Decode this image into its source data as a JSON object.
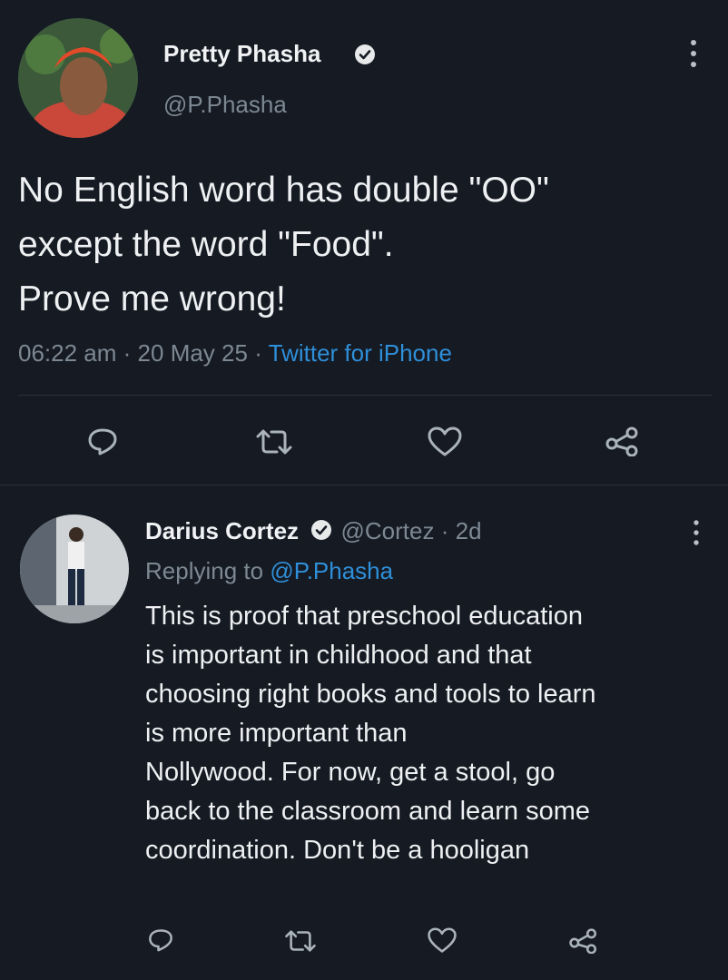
{
  "tweet": {
    "author_name": "Pretty Phasha",
    "author_handle": "@P.Phasha",
    "text_lines": [
      "No English word has double \"OO\"",
      "except the word \"Food\".",
      "Prove me wrong!"
    ],
    "time": "06:22 am",
    "date": "20 May 25",
    "source": "Twitter for iPhone",
    "separator": "·"
  },
  "reply": {
    "author_name": "Darius Cortez",
    "author_handle": "@Cortez",
    "age": "2d",
    "replying_prefix": "Replying to",
    "replying_handle": "@P.Phasha",
    "text_lines": [
      "This is proof that preschool education",
      "is important in childhood and that",
      "choosing right books and tools to learn",
      "is more important than",
      "Nollywood. For now, get a stool, go",
      "back to the classroom and learn some",
      "coordination. Don't be a hooligan"
    ]
  },
  "icons": {
    "reply": "reply-icon",
    "retweet": "retweet-icon",
    "like": "heart-icon",
    "share": "share-icon",
    "more": "more-options-icon",
    "verified": "verified-badge-icon"
  },
  "colors": {
    "background": "#151a23",
    "link": "#2f8fd8",
    "muted": "#7d8893",
    "text": "#e7e9ea"
  }
}
